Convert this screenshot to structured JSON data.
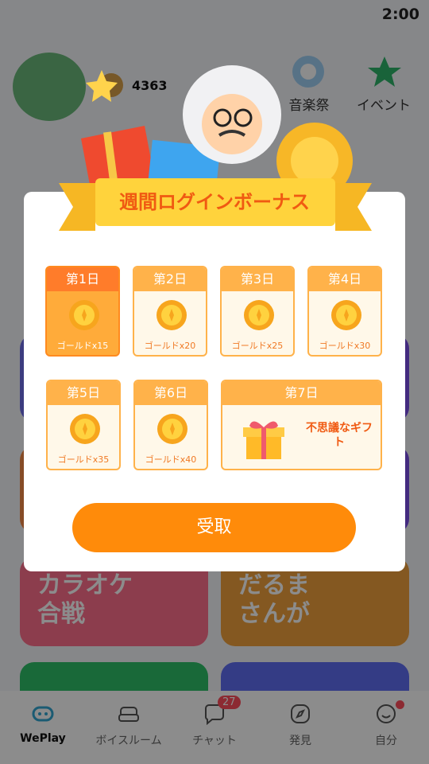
{
  "status_bar": {
    "time": "2:00"
  },
  "header": {
    "gold_count": "4363",
    "items": [
      {
        "label": "音楽祭"
      },
      {
        "label": "イベント"
      }
    ]
  },
  "cards": [
    {
      "title": "カラオケ\n合戦"
    },
    {
      "title": "だるま\nさんが"
    }
  ],
  "bottom_nav": [
    {
      "label": "WePlay",
      "active": true
    },
    {
      "label": "ボイスルーム"
    },
    {
      "label": "チャット",
      "badge": "27"
    },
    {
      "label": "発見"
    },
    {
      "label": "自分"
    }
  ],
  "modal": {
    "title": "週間ログインボーナス",
    "days": [
      {
        "day": "第1日",
        "reward": "ゴールドx15",
        "claimable": true
      },
      {
        "day": "第2日",
        "reward": "ゴールドx20"
      },
      {
        "day": "第3日",
        "reward": "ゴールドx25"
      },
      {
        "day": "第4日",
        "reward": "ゴールドx30"
      },
      {
        "day": "第5日",
        "reward": "ゴールドx35"
      },
      {
        "day": "第6日",
        "reward": "ゴールドx40"
      },
      {
        "day": "第7日",
        "reward": "不思議なギフト"
      }
    ],
    "button_label": "受取"
  }
}
